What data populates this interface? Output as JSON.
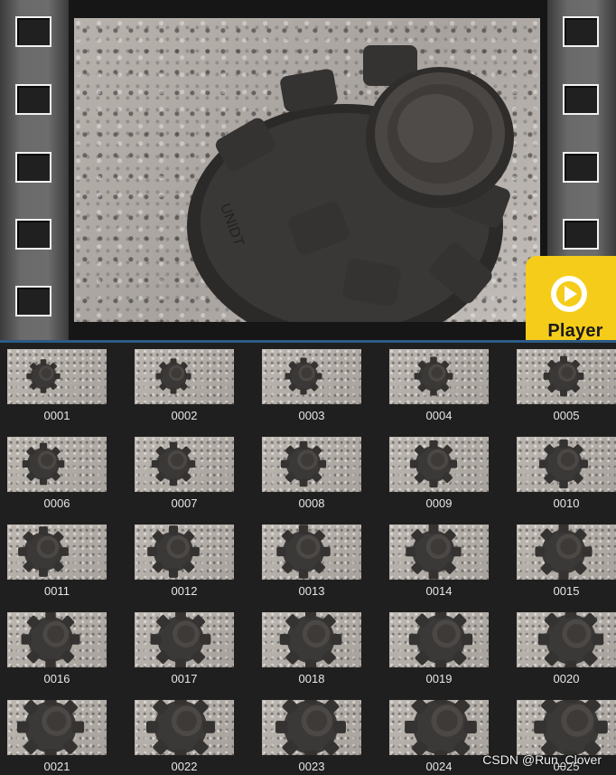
{
  "preview": {
    "sprocket_count": 5
  },
  "player": {
    "label": "Player",
    "icon": "play-icon",
    "color": "#f5cc19"
  },
  "thumbnails": [
    "0001",
    "0002",
    "0003",
    "0004",
    "0005",
    "0006",
    "0007",
    "0008",
    "0009",
    "0010",
    "0011",
    "0012",
    "0013",
    "0014",
    "0015",
    "0016",
    "0017",
    "0018",
    "0019",
    "0020",
    "0021",
    "0022",
    "0023",
    "0024",
    "0025"
  ],
  "watermark": "CSDN @Run_Clover",
  "colors": {
    "background": "#1f1f1f",
    "divider": "#2d5b86",
    "badge": "#f5cc19"
  }
}
